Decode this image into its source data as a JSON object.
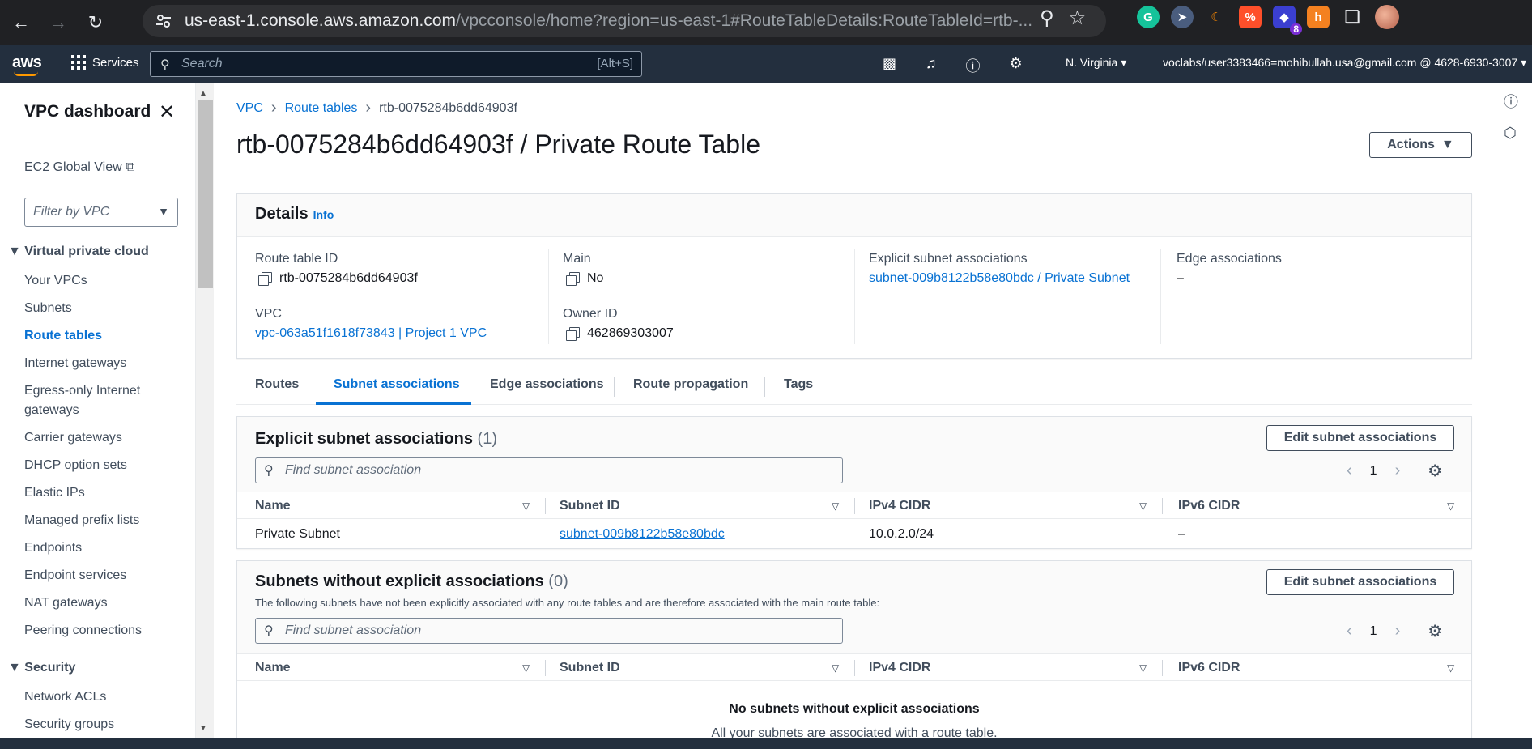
{
  "browser": {
    "url_host": "us-east-1.console.aws.amazon.com",
    "url_path": "/vpcconsole/home?region=us-east-1#RouteTableDetails:RouteTableId=rtb-...",
    "ext_badge": "8"
  },
  "aws_nav": {
    "logo": "aws",
    "services_label": "Services",
    "search_placeholder": "Search",
    "search_shortcut": "[Alt+S]",
    "region": "N. Virginia",
    "account": "voclabs/user3383466=mohibullah.usa@gmail.com @ 4628-6930-3007"
  },
  "sidebar": {
    "title": "VPC dashboard",
    "ec2_global_view": "EC2 Global View",
    "filter_placeholder": "Filter by VPC",
    "section_vpc": "Virtual private cloud",
    "vpc_items": [
      "Your VPCs",
      "Subnets",
      "Route tables",
      "Internet gateways",
      "Egress-only Internet",
      "gateways",
      "Carrier gateways",
      "DHCP option sets",
      "Elastic IPs",
      "Managed prefix lists",
      "Endpoints",
      "Endpoint services",
      "NAT gateways",
      "Peering connections"
    ],
    "section_security": "Security",
    "security_items": [
      "Network ACLs",
      "Security groups"
    ]
  },
  "breadcrumb": {
    "vpc": "VPC",
    "route_tables": "Route tables",
    "current": "rtb-0075284b6dd64903f"
  },
  "page_title": "rtb-0075284b6dd64903f / Private Route Table",
  "actions_label": "Actions",
  "details": {
    "title": "Details",
    "info": "Info",
    "route_table_id_label": "Route table ID",
    "route_table_id": "rtb-0075284b6dd64903f",
    "main_label": "Main",
    "main_value": "No",
    "explicit_label": "Explicit subnet associations",
    "explicit_value": "subnet-009b8122b58e80bdc / Private Subnet",
    "edge_label": "Edge associations",
    "edge_value": "–",
    "vpc_label": "VPC",
    "vpc_value": "vpc-063a51f1618f73843 | Project 1 VPC",
    "owner_label": "Owner ID",
    "owner_value": "462869303007"
  },
  "tabs": [
    "Routes",
    "Subnet associations",
    "Edge associations",
    "Route propagation",
    "Tags"
  ],
  "explicit_section": {
    "title": "Explicit subnet associations",
    "count": "(1)",
    "edit_button": "Edit subnet associations",
    "find_placeholder": "Find subnet association",
    "page": "1",
    "columns": [
      "Name",
      "Subnet ID",
      "IPv4 CIDR",
      "IPv6 CIDR"
    ],
    "rows": [
      {
        "name": "Private Subnet",
        "subnet_id": "subnet-009b8122b58e80bdc",
        "ipv4": "10.0.2.0/24",
        "ipv6": "–"
      }
    ]
  },
  "without_section": {
    "title": "Subnets without explicit associations",
    "count": "(0)",
    "description": "The following subnets have not been explicitly associated with any route tables and are therefore associated with the main route table:",
    "edit_button": "Edit subnet associations",
    "find_placeholder": "Find subnet association",
    "page": "1",
    "columns": [
      "Name",
      "Subnet ID",
      "IPv4 CIDR",
      "IPv6 CIDR"
    ],
    "empty_title": "No subnets without explicit associations",
    "empty_desc": "All your subnets are associated with a route table."
  }
}
